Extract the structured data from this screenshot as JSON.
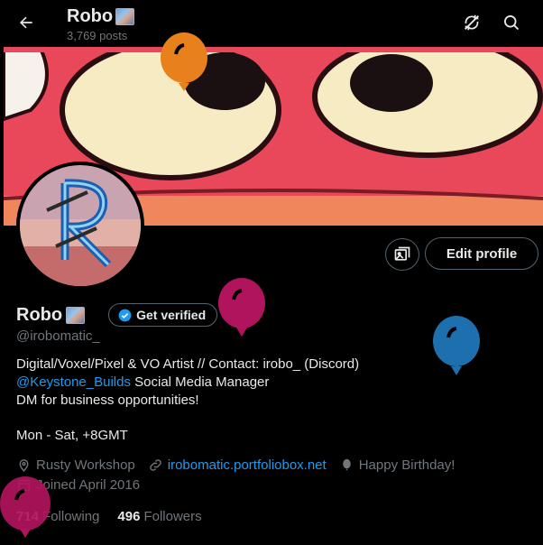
{
  "header": {
    "title": "Robo",
    "posts": "3,769 posts"
  },
  "icons": {
    "back": "arrow-left-icon",
    "no_sync": "sync-off-icon",
    "search": "search-icon",
    "photo": "photo-gallery-icon",
    "verified": "verified-badge-icon",
    "location": "location-pin-icon",
    "link": "link-icon",
    "birthday": "balloon-icon",
    "calendar": "calendar-icon"
  },
  "actions": {
    "edit_profile": "Edit profile",
    "get_verified": "Get verified"
  },
  "profile": {
    "name": "Robo",
    "handle": "@irobomatic_",
    "bio_line1": "Digital/Voxel/Pixel & VO Artist // Contact: irobo_ (Discord)",
    "bio_mention": "@Keystone_Builds",
    "bio_line2_rest": " Social Media Manager",
    "bio_line3": "DM for business opportunities!",
    "schedule": "Mon - Sat, +8GMT",
    "location": "Rusty Workshop",
    "website": "irobomatic.portfoliobox.net",
    "birthday": "Happy Birthday!",
    "joined": "Joined April 2016"
  },
  "stats": {
    "following_count": "714",
    "following_label": "Following",
    "followers_count": "496",
    "followers_label": "Followers"
  },
  "colors": {
    "background": "#000000",
    "text": "#e7e9ea",
    "muted": "#71767b",
    "accent": "#1d9bf0",
    "banner_red": "#e8485a",
    "balloon_orange": "#e8801c",
    "balloon_magenta": "#b0145c",
    "balloon_blue": "#1d6fae"
  }
}
